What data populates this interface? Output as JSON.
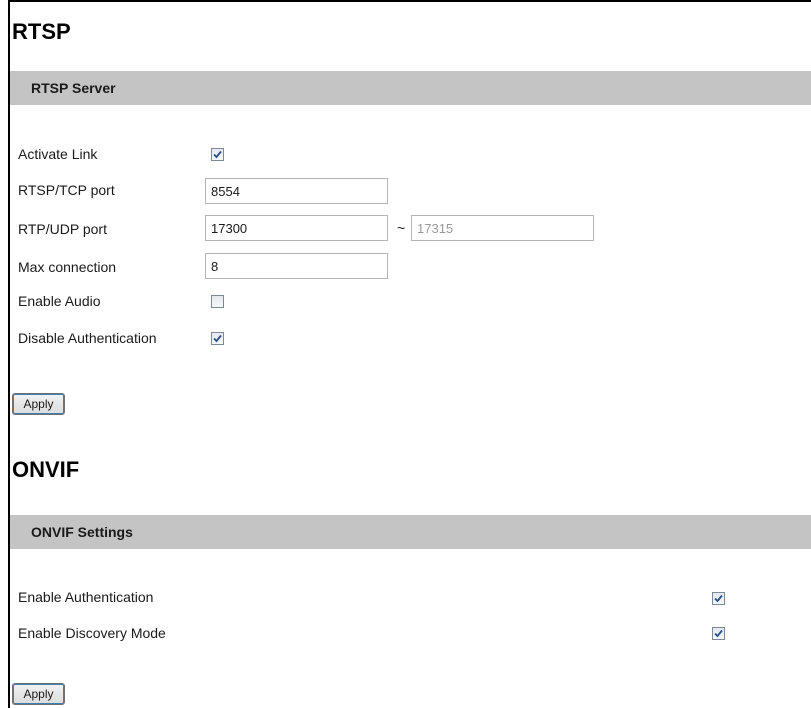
{
  "rtsp": {
    "title": "RTSP",
    "section_label": "RTSP Server",
    "activate_link": {
      "label": "Activate Link",
      "checked": true
    },
    "rtsp_tcp_port": {
      "label": "RTSP/TCP port",
      "value": "8554"
    },
    "rtp_udp_port": {
      "label": "RTP/UDP port",
      "value_start": "17300",
      "separator": "~",
      "value_end": "17315"
    },
    "max_connection": {
      "label": "Max connection",
      "value": "8"
    },
    "enable_audio": {
      "label": "Enable Audio",
      "checked": false
    },
    "disable_authentication": {
      "label": "Disable Authentication",
      "checked": true
    },
    "apply_label": "Apply"
  },
  "onvif": {
    "title": "ONVIF",
    "section_label": "ONVIF Settings",
    "enable_authentication": {
      "label": "Enable Authentication",
      "checked": true
    },
    "enable_discovery_mode": {
      "label": "Enable Discovery Mode",
      "checked": true
    },
    "apply_label": "Apply"
  },
  "colors": {
    "section_bar": "#c4c4c4",
    "check_mark": "#2b4f8a"
  },
  "icons": {
    "checkmark": "checkmark-icon"
  }
}
